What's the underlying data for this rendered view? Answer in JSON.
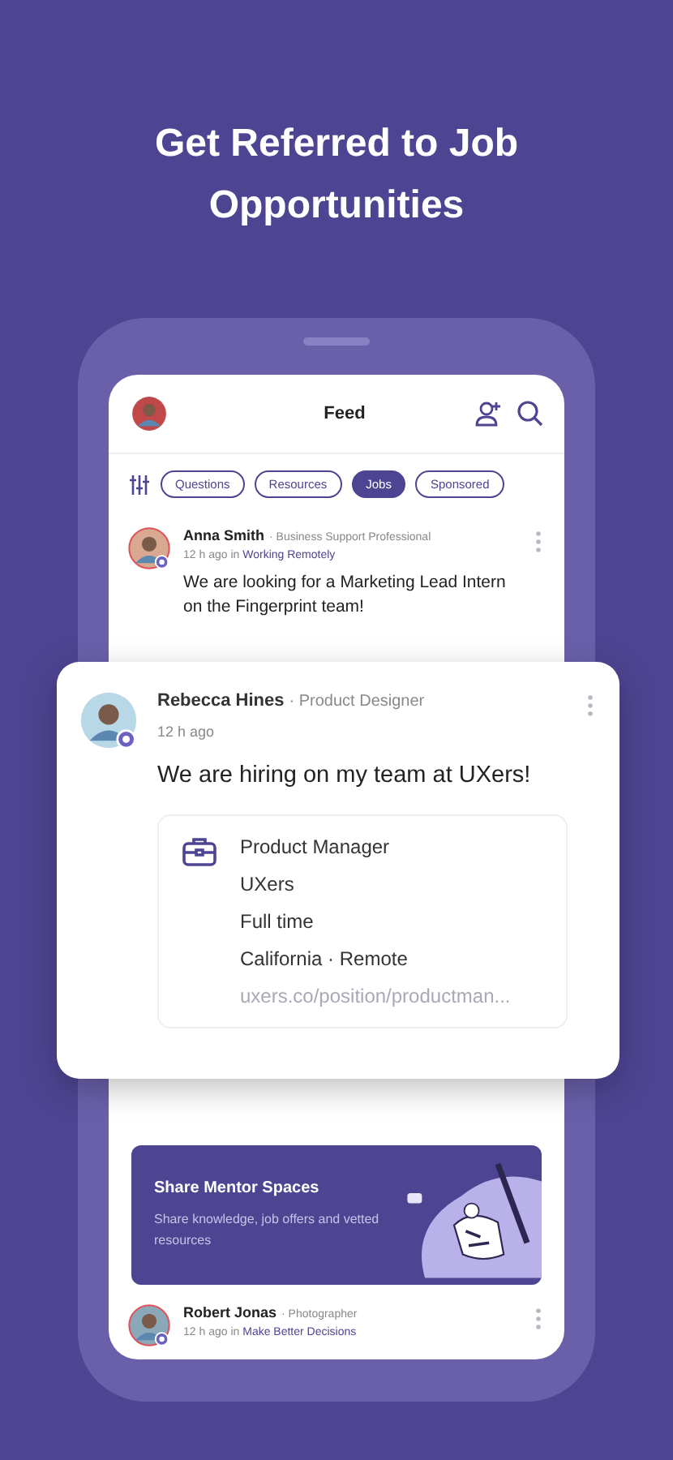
{
  "headline": "Get Referred to Job Opportunities",
  "header": {
    "title": "Feed"
  },
  "filters": [
    {
      "label": "Questions",
      "selected": false
    },
    {
      "label": "Resources",
      "selected": false
    },
    {
      "label": "Jobs",
      "selected": true
    },
    {
      "label": "Sponsored",
      "selected": false
    }
  ],
  "top_post": {
    "name": "Anna Smith",
    "role": "· Business Support Professional",
    "time": "12 h ago in",
    "space": "Working Remotely",
    "text": "We are looking for a Marketing Lead Intern on the Fingerprint team!"
  },
  "featured_post": {
    "name": "Rebecca Hines",
    "role": "· Product Designer",
    "time": "12 h ago",
    "text": "We are hiring on my team at UXers!",
    "job": {
      "title": "Product Manager",
      "company": "UXers",
      "type": "Full time",
      "location": "California · Remote",
      "link": "uxers.co/position/productman..."
    }
  },
  "banner": {
    "title": "Share Mentor Spaces",
    "text": "Share knowledge, job offers and vetted resources"
  },
  "bottom_post": {
    "name": "Robert Jonas",
    "role": "· Photographer",
    "time": "12 h ago in",
    "space": "Make Better Decisions"
  }
}
